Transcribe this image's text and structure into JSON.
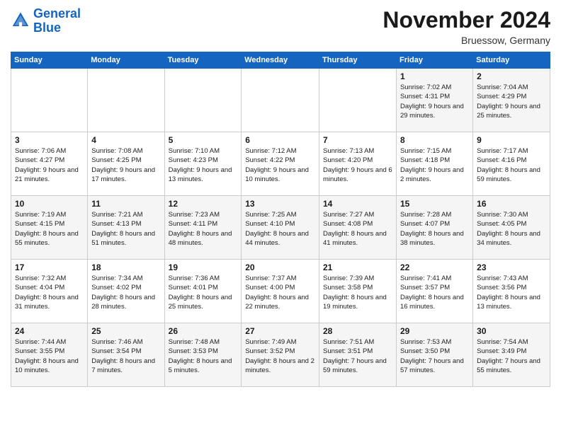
{
  "header": {
    "logo_line1": "General",
    "logo_line2": "Blue",
    "month_title": "November 2024",
    "location": "Bruessow, Germany"
  },
  "weekdays": [
    "Sunday",
    "Monday",
    "Tuesday",
    "Wednesday",
    "Thursday",
    "Friday",
    "Saturday"
  ],
  "weeks": [
    [
      {
        "day": "",
        "info": ""
      },
      {
        "day": "",
        "info": ""
      },
      {
        "day": "",
        "info": ""
      },
      {
        "day": "",
        "info": ""
      },
      {
        "day": "",
        "info": ""
      },
      {
        "day": "1",
        "info": "Sunrise: 7:02 AM\nSunset: 4:31 PM\nDaylight: 9 hours and 29 minutes."
      },
      {
        "day": "2",
        "info": "Sunrise: 7:04 AM\nSunset: 4:29 PM\nDaylight: 9 hours and 25 minutes."
      }
    ],
    [
      {
        "day": "3",
        "info": "Sunrise: 7:06 AM\nSunset: 4:27 PM\nDaylight: 9 hours and 21 minutes."
      },
      {
        "day": "4",
        "info": "Sunrise: 7:08 AM\nSunset: 4:25 PM\nDaylight: 9 hours and 17 minutes."
      },
      {
        "day": "5",
        "info": "Sunrise: 7:10 AM\nSunset: 4:23 PM\nDaylight: 9 hours and 13 minutes."
      },
      {
        "day": "6",
        "info": "Sunrise: 7:12 AM\nSunset: 4:22 PM\nDaylight: 9 hours and 10 minutes."
      },
      {
        "day": "7",
        "info": "Sunrise: 7:13 AM\nSunset: 4:20 PM\nDaylight: 9 hours and 6 minutes."
      },
      {
        "day": "8",
        "info": "Sunrise: 7:15 AM\nSunset: 4:18 PM\nDaylight: 9 hours and 2 minutes."
      },
      {
        "day": "9",
        "info": "Sunrise: 7:17 AM\nSunset: 4:16 PM\nDaylight: 8 hours and 59 minutes."
      }
    ],
    [
      {
        "day": "10",
        "info": "Sunrise: 7:19 AM\nSunset: 4:15 PM\nDaylight: 8 hours and 55 minutes."
      },
      {
        "day": "11",
        "info": "Sunrise: 7:21 AM\nSunset: 4:13 PM\nDaylight: 8 hours and 51 minutes."
      },
      {
        "day": "12",
        "info": "Sunrise: 7:23 AM\nSunset: 4:11 PM\nDaylight: 8 hours and 48 minutes."
      },
      {
        "day": "13",
        "info": "Sunrise: 7:25 AM\nSunset: 4:10 PM\nDaylight: 8 hours and 44 minutes."
      },
      {
        "day": "14",
        "info": "Sunrise: 7:27 AM\nSunset: 4:08 PM\nDaylight: 8 hours and 41 minutes."
      },
      {
        "day": "15",
        "info": "Sunrise: 7:28 AM\nSunset: 4:07 PM\nDaylight: 8 hours and 38 minutes."
      },
      {
        "day": "16",
        "info": "Sunrise: 7:30 AM\nSunset: 4:05 PM\nDaylight: 8 hours and 34 minutes."
      }
    ],
    [
      {
        "day": "17",
        "info": "Sunrise: 7:32 AM\nSunset: 4:04 PM\nDaylight: 8 hours and 31 minutes."
      },
      {
        "day": "18",
        "info": "Sunrise: 7:34 AM\nSunset: 4:02 PM\nDaylight: 8 hours and 28 minutes."
      },
      {
        "day": "19",
        "info": "Sunrise: 7:36 AM\nSunset: 4:01 PM\nDaylight: 8 hours and 25 minutes."
      },
      {
        "day": "20",
        "info": "Sunrise: 7:37 AM\nSunset: 4:00 PM\nDaylight: 8 hours and 22 minutes."
      },
      {
        "day": "21",
        "info": "Sunrise: 7:39 AM\nSunset: 3:58 PM\nDaylight: 8 hours and 19 minutes."
      },
      {
        "day": "22",
        "info": "Sunrise: 7:41 AM\nSunset: 3:57 PM\nDaylight: 8 hours and 16 minutes."
      },
      {
        "day": "23",
        "info": "Sunrise: 7:43 AM\nSunset: 3:56 PM\nDaylight: 8 hours and 13 minutes."
      }
    ],
    [
      {
        "day": "24",
        "info": "Sunrise: 7:44 AM\nSunset: 3:55 PM\nDaylight: 8 hours and 10 minutes."
      },
      {
        "day": "25",
        "info": "Sunrise: 7:46 AM\nSunset: 3:54 PM\nDaylight: 8 hours and 7 minutes."
      },
      {
        "day": "26",
        "info": "Sunrise: 7:48 AM\nSunset: 3:53 PM\nDaylight: 8 hours and 5 minutes."
      },
      {
        "day": "27",
        "info": "Sunrise: 7:49 AM\nSunset: 3:52 PM\nDaylight: 8 hours and 2 minutes."
      },
      {
        "day": "28",
        "info": "Sunrise: 7:51 AM\nSunset: 3:51 PM\nDaylight: 7 hours and 59 minutes."
      },
      {
        "day": "29",
        "info": "Sunrise: 7:53 AM\nSunset: 3:50 PM\nDaylight: 7 hours and 57 minutes."
      },
      {
        "day": "30",
        "info": "Sunrise: 7:54 AM\nSunset: 3:49 PM\nDaylight: 7 hours and 55 minutes."
      }
    ]
  ]
}
